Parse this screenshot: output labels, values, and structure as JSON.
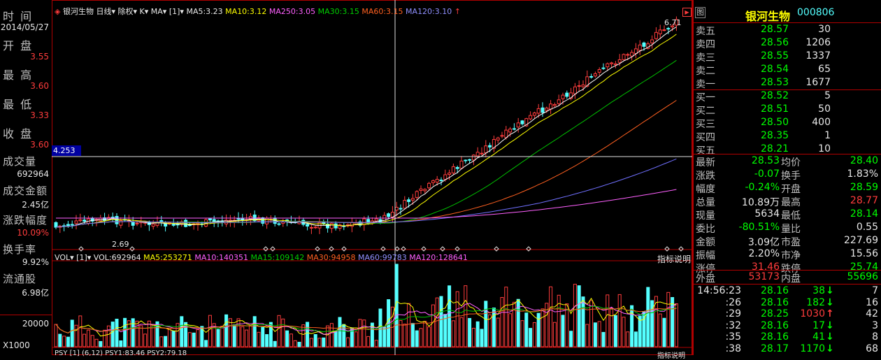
{
  "left_panel": {
    "items": [
      {
        "label": "时  间",
        "value": "2014/05/27",
        "color": "#e8e8e8"
      },
      {
        "label": "开  盘",
        "value": "3.55",
        "color": "#ff3c3c"
      },
      {
        "label": "最  高",
        "value": "3.60",
        "color": "#ff3c3c"
      },
      {
        "label": "最  低",
        "value": "3.33",
        "color": "#ff3c3c"
      },
      {
        "label": "收  盘",
        "value": "3.60",
        "color": "#ff3c3c"
      },
      {
        "label": "成交量",
        "value": "692964",
        "color": "#e8e8e8"
      },
      {
        "label": "成交金额",
        "value": "2.45亿",
        "color": "#e8e8e8"
      },
      {
        "label": "涨跌幅度",
        "value": "10.09%",
        "color": "#ff3c3c"
      },
      {
        "label": "换手率",
        "value": "9.92%",
        "color": "#e8e8e8"
      },
      {
        "label": "流通股",
        "value": "6.98亿",
        "color": "#e8e8e8"
      }
    ],
    "vol_scale": "20000",
    "vol_unit": "X1000"
  },
  "price_header": {
    "stock": "银河生物",
    "period": "日线",
    "adjust": "除权",
    "kind": "K",
    "indicator": "MA",
    "param": "[1]",
    "ma5": "MA5:3.23",
    "ma10": "MA10:3.12",
    "ma250": "MA250:3.05",
    "ma30": "MA30:3.15",
    "ma60": "MA60:3.15",
    "ma120": "MA120:3.10"
  },
  "price_labels": {
    "crosshair_value": "4.253",
    "high_mark": "6.71",
    "low_mark": "2.69"
  },
  "vol_header": {
    "name": "VOL",
    "param": "[1]",
    "vol": "VOL:692964",
    "ma5": "MA5:253271",
    "ma10": "MA10:140351",
    "ma15": "MA15:109142",
    "ma30": "MA30:94958",
    "ma60": "MA60:99783",
    "ma120": "MA120:128641",
    "explain": "指标说明"
  },
  "bottom_header": {
    "text": "PSY  [1] (6,12) PSY1:83.46 PSY2:79.18",
    "explain": "指标说明"
  },
  "colors": {
    "up": "#ff3c3c",
    "down": "#54ffff",
    "ma5": "#ffffff",
    "ma10": "#ffff00",
    "ma30": "#00c000",
    "ma60": "#ff6020",
    "ma120": "#7070ff",
    "ma250": "#ff60ff",
    "grid": "#b00000"
  },
  "right_panel": {
    "icon_label": "图",
    "name": "银河生物",
    "code": "000806",
    "sell": [
      {
        "label": "卖五",
        "price": "28.57",
        "qty": "30"
      },
      {
        "label": "卖四",
        "price": "28.56",
        "qty": "1206"
      },
      {
        "label": "卖三",
        "price": "28.55",
        "qty": "1337"
      },
      {
        "label": "卖二",
        "price": "28.54",
        "qty": "65"
      },
      {
        "label": "卖一",
        "price": "28.53",
        "qty": "1677"
      }
    ],
    "buy": [
      {
        "label": "买一",
        "price": "28.52",
        "qty": "5"
      },
      {
        "label": "买二",
        "price": "28.51",
        "qty": "50"
      },
      {
        "label": "买三",
        "price": "28.50",
        "qty": "400"
      },
      {
        "label": "买四",
        "price": "28.35",
        "qty": "1"
      },
      {
        "label": "买五",
        "price": "28.21",
        "qty": "10"
      }
    ],
    "stats": [
      {
        "l1": "最新",
        "v1": "28.53",
        "c1": "#00ff00",
        "l2": "均价",
        "v2": "28.40",
        "c2": "#00ff00"
      },
      {
        "l1": "涨跌",
        "v1": "-0.07",
        "c1": "#00ff00",
        "l2": "换手",
        "v2": "1.83%",
        "c2": "#e8e8e8"
      },
      {
        "l1": "幅度",
        "v1": "-0.24%",
        "c1": "#00ff00",
        "l2": "开盘",
        "v2": "28.59",
        "c2": "#00ff00"
      },
      {
        "l1": "总量",
        "v1": "10.89万",
        "c1": "#e8e8e8",
        "l2": "最高",
        "v2": "28.77",
        "c2": "#ff3c3c"
      },
      {
        "l1": "现量",
        "v1": "5634",
        "c1": "#e8e8e8",
        "l2": "最低",
        "v2": "28.14",
        "c2": "#00ff00"
      },
      {
        "l1": "委比",
        "v1": "-80.51%",
        "c1": "#00ff00",
        "l2": "量比",
        "v2": "0.55",
        "c2": "#e8e8e8"
      },
      {
        "l1": "金额",
        "v1": "3.09亿",
        "c1": "#e8e8e8",
        "l2": "市盈",
        "v2": "227.69",
        "c2": "#e8e8e8"
      },
      {
        "l1": "振幅",
        "v1": "2.20%",
        "c1": "#e8e8e8",
        "l2": "市净",
        "v2": "15.56",
        "c2": "#e8e8e8"
      },
      {
        "l1": "涨停",
        "v1": "31.46",
        "c1": "#ff3c3c",
        "l2": "跌停",
        "v2": "25.74",
        "c2": "#00ff00"
      }
    ],
    "outer": {
      "label": "外盘",
      "value": "53173"
    },
    "inner": {
      "label": "内盘",
      "value": "55696"
    },
    "ticks": [
      {
        "time": "14:56:23",
        "price": "28.16",
        "vol": "38",
        "dir": "down",
        "n": "7"
      },
      {
        "time": ":26",
        "price": "28.16",
        "vol": "182",
        "dir": "down",
        "n": "16"
      },
      {
        "time": ":29",
        "price": "28.25",
        "vol": "1030",
        "dir": "up",
        "n": "42"
      },
      {
        "time": ":32",
        "price": "28.16",
        "vol": "17",
        "dir": "down",
        "n": "3"
      },
      {
        "time": ":35",
        "price": "28.16",
        "vol": "41",
        "dir": "down",
        "n": "8"
      },
      {
        "time": ":38",
        "price": "28.17",
        "vol": "1170",
        "dir": "down",
        "n": "68"
      }
    ]
  }
}
